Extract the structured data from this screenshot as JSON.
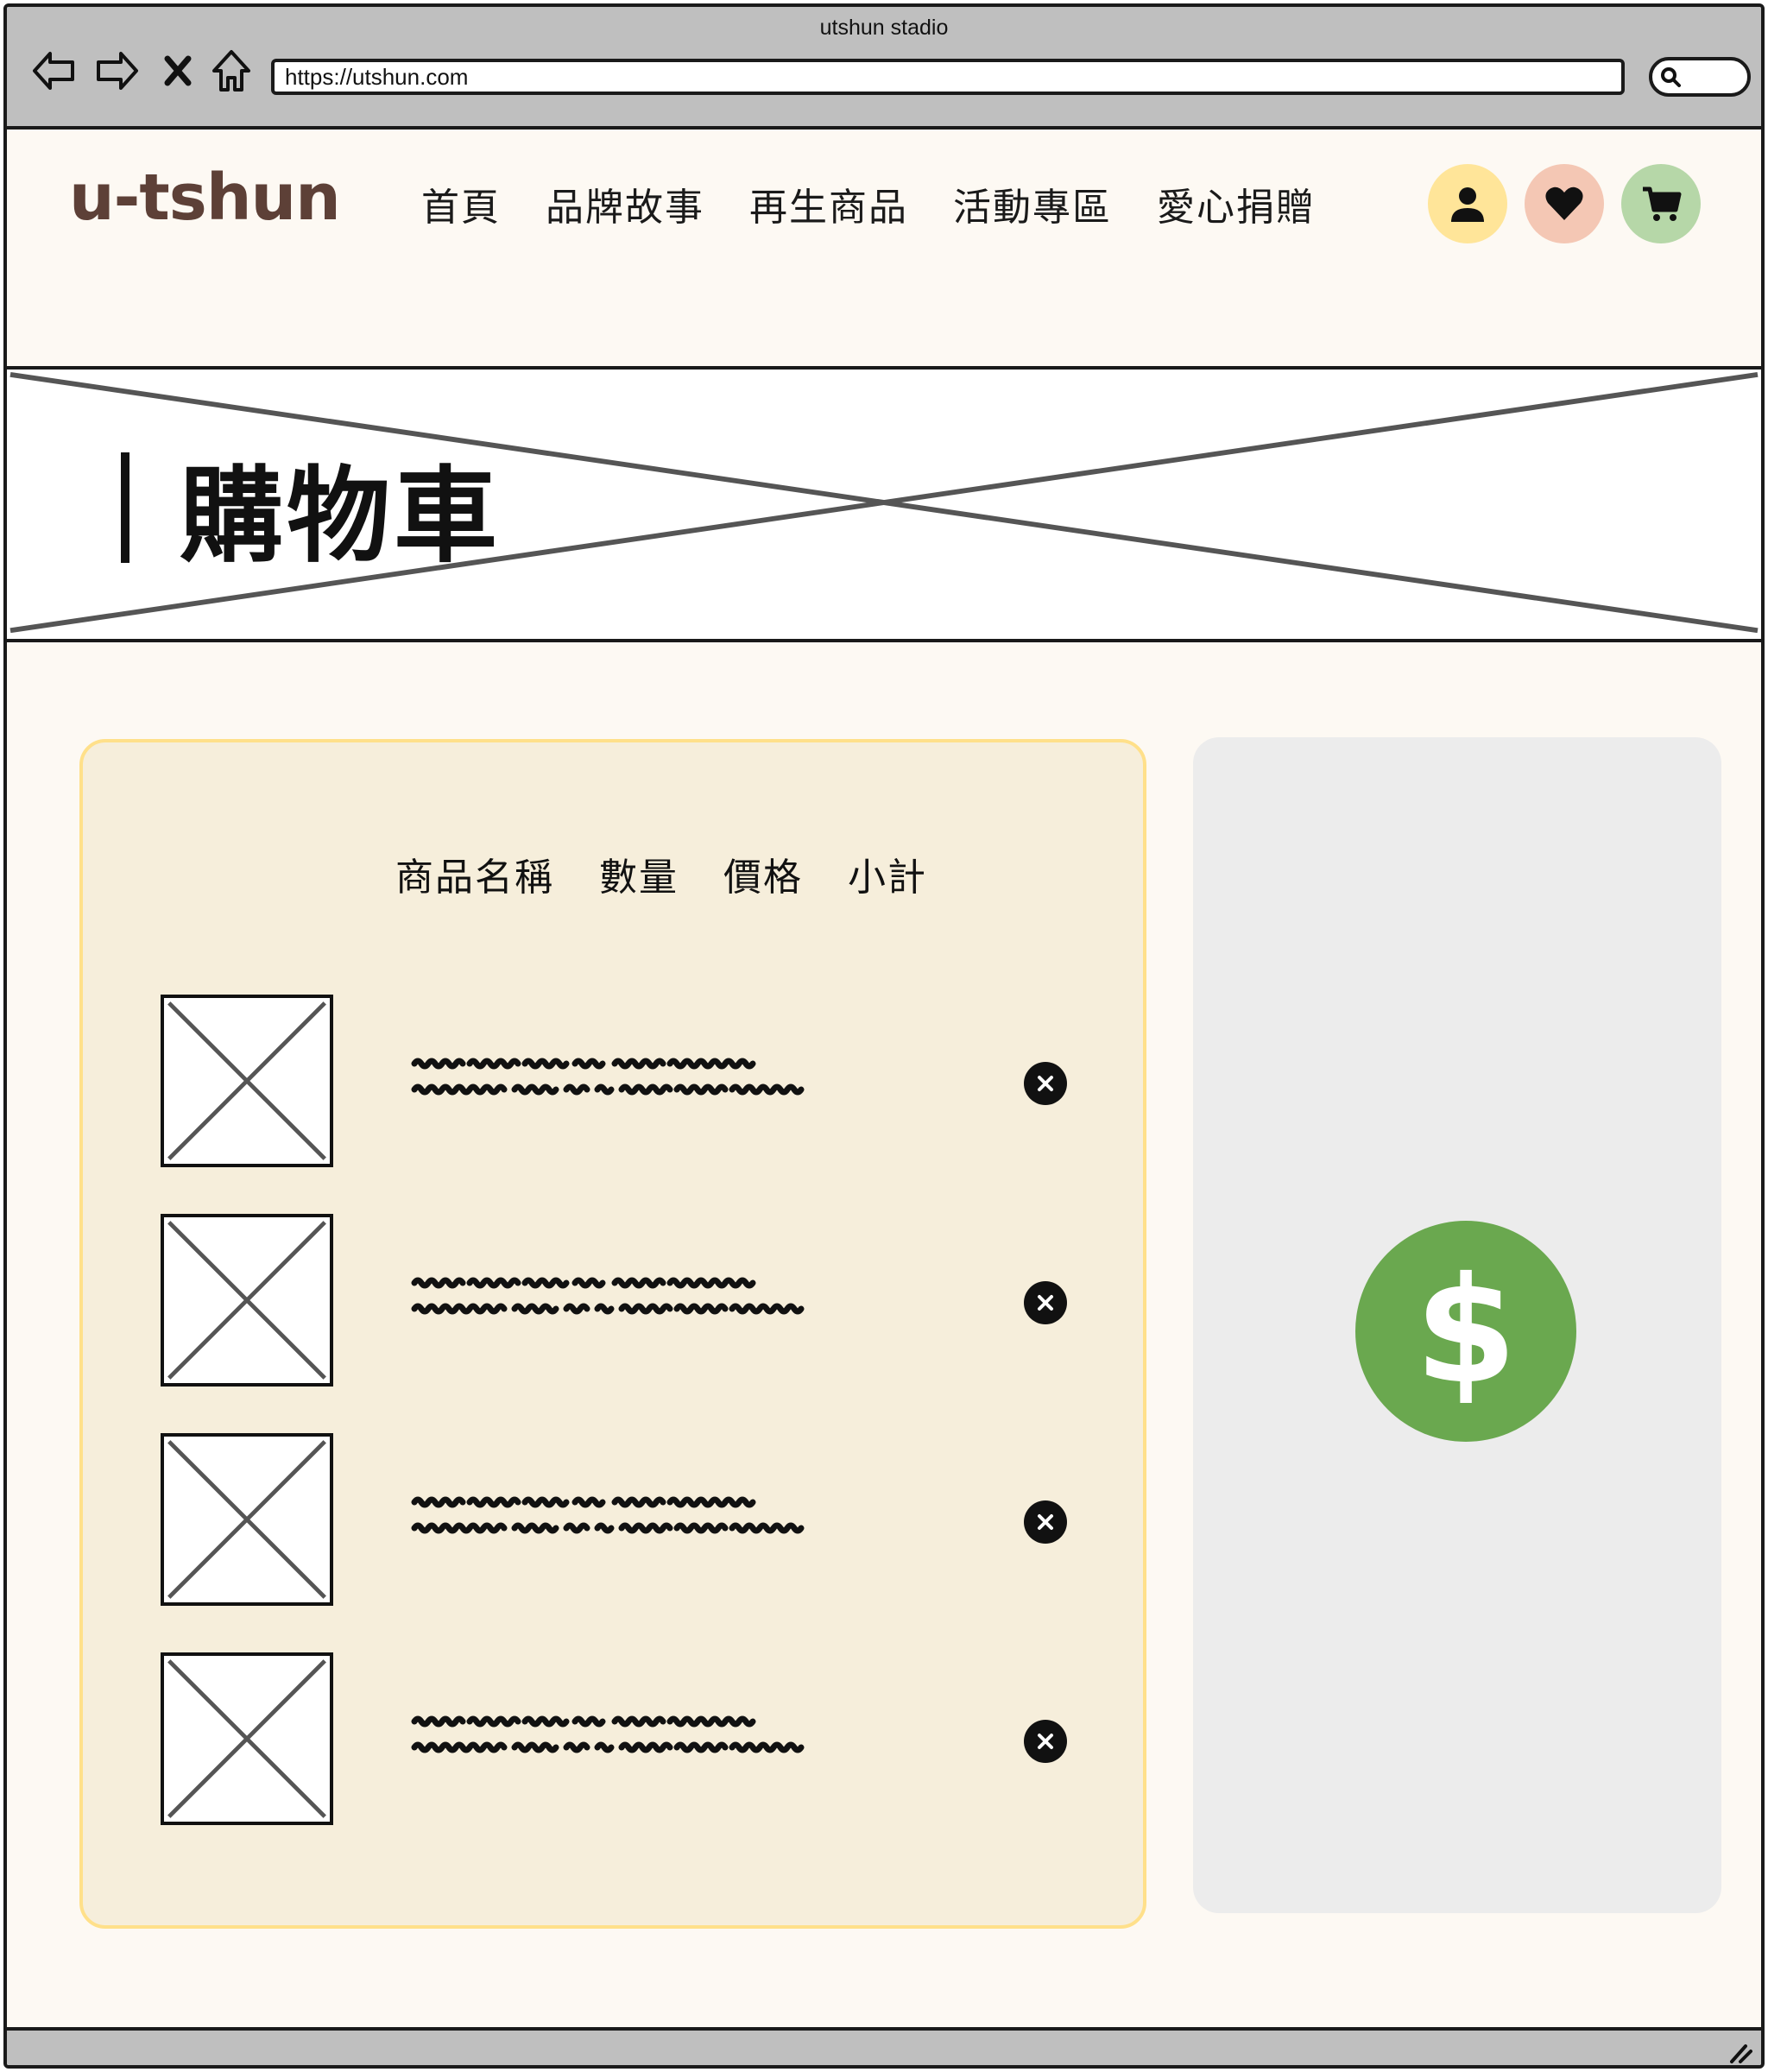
{
  "window": {
    "title": "utshun stadio"
  },
  "browser": {
    "url": "https://utshun.com",
    "icons": [
      "back-arrow-icon",
      "forward-arrow-icon",
      "close-icon",
      "home-icon",
      "search-icon"
    ]
  },
  "header": {
    "logo": "u-tshun",
    "nav": [
      "首頁",
      "品牌故事",
      "再生商品",
      "活動專區",
      "愛心捐贈"
    ],
    "icons": [
      {
        "name": "user-icon",
        "color": "#ffe599"
      },
      {
        "name": "heart-icon",
        "color": "#f4c7b4"
      },
      {
        "name": "cart-icon",
        "color": "#b6d7a8"
      }
    ]
  },
  "banner": {
    "title": "購物車"
  },
  "cart": {
    "columns": [
      "商品名稱",
      "數量",
      "價格",
      "小計"
    ],
    "item_count": 4
  },
  "checkout": {
    "symbol": "$",
    "color": "#6aa84f"
  },
  "colors": {
    "chrome": "#bfbfbf",
    "page_bg": "#fdf9f3",
    "cart_panel": "#f6eedb",
    "cart_border": "#ffe08a",
    "checkout_panel": "#ececec",
    "logo": "#5d4037"
  }
}
